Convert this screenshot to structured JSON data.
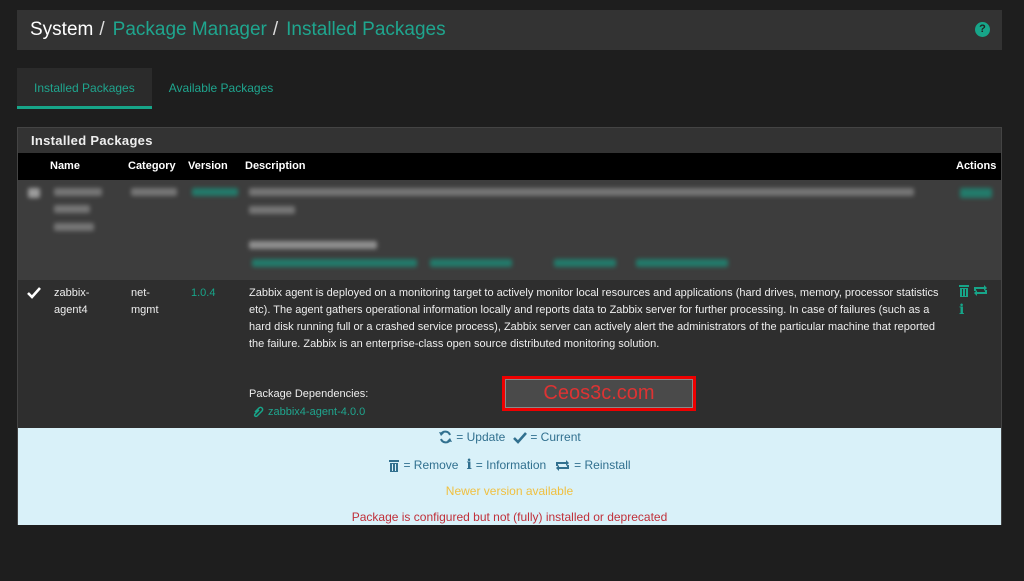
{
  "breadcrumb": {
    "system": "System",
    "separator": "/",
    "package_manager": "Package Manager",
    "installed_packages": "Installed Packages",
    "help_icon": "?"
  },
  "tabs": [
    {
      "label": "Installed Packages",
      "active": true
    },
    {
      "label": "Available Packages",
      "active": false
    }
  ],
  "panel": {
    "title": "Installed Packages",
    "columns": {
      "name": "Name",
      "category": "Category",
      "version": "Version",
      "description": "Description",
      "actions": "Actions"
    },
    "rows": [
      {
        "blurred": true,
        "name": "",
        "category": "",
        "version": "",
        "description": "",
        "deps_label": "Package Dependencies:"
      },
      {
        "blurred": false,
        "status_icon": "check-icon",
        "name_line1": "zabbix-",
        "name_line2": "agent4",
        "category_line1": "net-",
        "category_line2": "mgmt",
        "version": "1.0.4",
        "description": "Zabbix agent is deployed on a monitoring target to actively monitor local resources and applications (hard drives, memory, processor statistics etc). The agent gathers operational information locally and reports data to Zabbix server for further processing. In case of failures (such as a hard disk running full or a crashed service process), Zabbix server can actively alert the administrators of the particular machine that reported the failure. Zabbix is an enterprise-class open source distributed monitoring solution.",
        "deps_label": "Package Dependencies:",
        "dependency": "zabbix4-agent-4.0.0",
        "watermark": "Ceos3c.com"
      }
    ]
  },
  "legend": {
    "update": "= Update",
    "current": "= Current",
    "remove": "= Remove",
    "information": "= Information",
    "reinstall": "= Reinstall",
    "newer": "Newer version available",
    "deprecated": "Package is configured but not (fully) installed or deprecated"
  },
  "colors": {
    "accent": "#17a589",
    "legend_bg": "#d9f1f9",
    "legend_text": "#31708f",
    "warning": "#f0c040",
    "danger": "#c0303a"
  }
}
